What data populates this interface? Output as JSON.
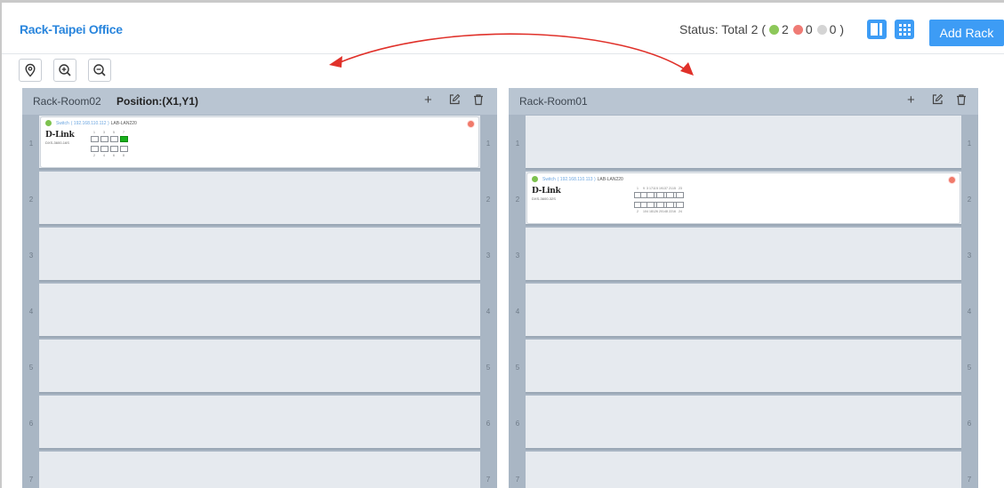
{
  "header": {
    "title": "Rack-Taipei Office",
    "status_label": "Status: Total 2 (",
    "status_close": ")",
    "counts": {
      "online": "2",
      "offline": "0",
      "unknown": "0"
    },
    "colors": {
      "online": "#8dc85a",
      "offline": "#ef7b75",
      "unknown": "#d4d4d4",
      "accent": "#3d9cf5"
    },
    "add_rack_label": "Add Rack"
  },
  "toolbar": {
    "icons": [
      "location-icon",
      "zoom-in-icon",
      "zoom-out-icon"
    ]
  },
  "racks": [
    {
      "name": "Rack-Room02",
      "position": "Position:(X1,Y1)",
      "actions": [
        "+",
        "edit-icon",
        "trash-icon"
      ],
      "units": [
        "1",
        "2",
        "3",
        "4",
        "5",
        "6",
        "7"
      ],
      "device": {
        "unit": "1",
        "type": "Switch",
        "ip": "( 192.168.110.112 )",
        "name": "LAB-LAN220",
        "brand": "D-Link",
        "model": "DXS-3600-16S",
        "top_labels": [
          "1",
          "3",
          "5",
          "7"
        ],
        "bottom_labels": [
          "2",
          "4",
          "6",
          "8"
        ]
      }
    },
    {
      "name": "Rack-Room01",
      "position": "",
      "actions": [
        "+",
        "edit-icon",
        "trash-icon"
      ],
      "units": [
        "1",
        "2",
        "3",
        "4",
        "5",
        "6",
        "7"
      ],
      "device": {
        "unit": "2",
        "type": "Switch",
        "ip": "( 192.168.110.113 )",
        "name": "LAB-LAN220",
        "brand": "D-Link",
        "model": "DXS-3600-32S",
        "top_labels": [
          "1",
          "3",
          "5",
          "7",
          "9",
          "11",
          "13",
          "15",
          "17",
          "19",
          "21",
          "23"
        ],
        "bottom_labels": [
          "2",
          "4",
          "6",
          "8",
          "10",
          "12",
          "14",
          "16",
          "18",
          "20",
          "22",
          "24"
        ]
      }
    }
  ]
}
